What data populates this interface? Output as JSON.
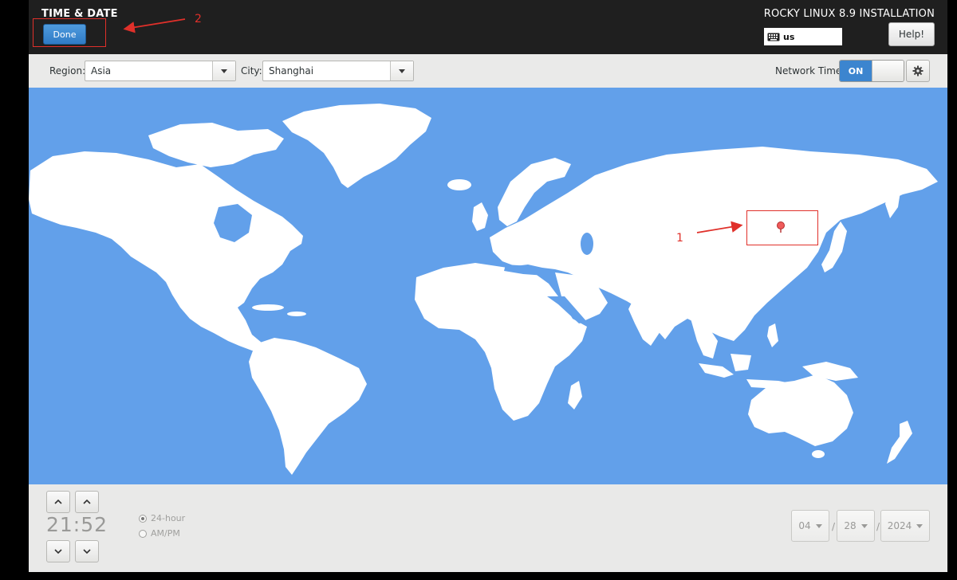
{
  "header": {
    "screen_title": "TIME & DATE",
    "done_label": "Done",
    "product_title": "ROCKY LINUX 8.9 INSTALLATION",
    "keyboard_layout": "us",
    "help_label": "Help!"
  },
  "toolbar": {
    "region_label": "Region:",
    "region_value": "Asia",
    "city_label": "City:",
    "city_value": "Shanghai",
    "network_time_label": "Network Time",
    "network_time_state": "ON"
  },
  "map": {
    "ocean_color": "#62a0ea",
    "land_color": "#ffffff",
    "marker_icon": "location-pin-icon"
  },
  "time": {
    "value": "21:52",
    "format_24h_label": "24-hour",
    "format_ampm_label": "AM/PM",
    "selected_format": "24-hour"
  },
  "date": {
    "month": "04",
    "day": "28",
    "year": "2024",
    "separator": "/"
  },
  "annotations": {
    "marker_1": "1",
    "marker_2": "2",
    "color": "#e0302a"
  }
}
